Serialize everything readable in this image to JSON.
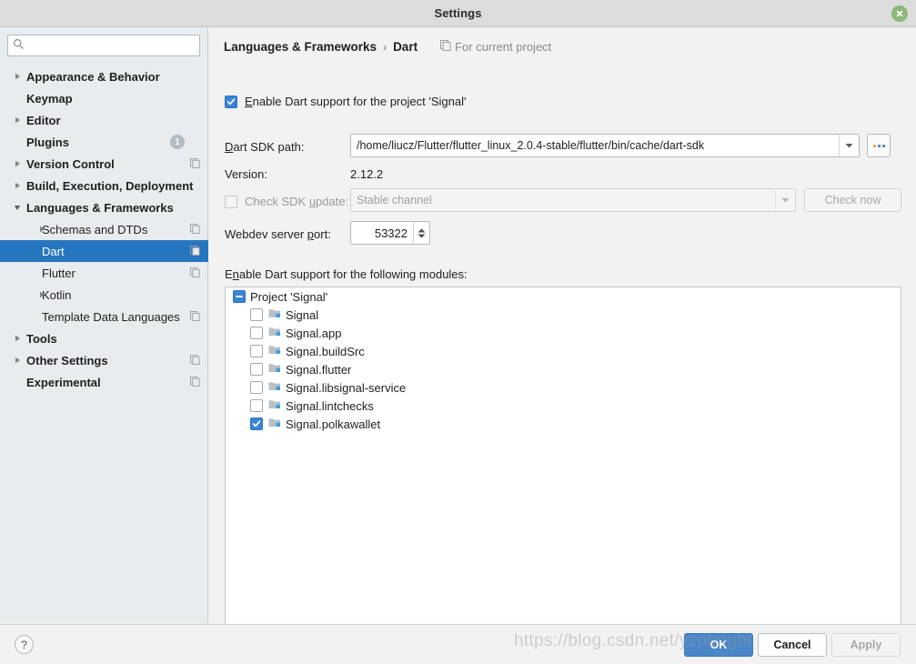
{
  "window": {
    "title": "Settings",
    "close_icon": "close-icon"
  },
  "sidebar": {
    "search": {
      "value": "",
      "placeholder": "",
      "icon": "search-icon"
    },
    "items": [
      {
        "label": "Appearance & Behavior",
        "level": 0,
        "bold": true,
        "arrow": "collapsed",
        "badge": "",
        "scope_icon": false
      },
      {
        "label": "Keymap",
        "level": 0,
        "bold": true,
        "arrow": "none",
        "badge": "",
        "scope_icon": false
      },
      {
        "label": "Editor",
        "level": 0,
        "bold": true,
        "arrow": "collapsed",
        "badge": "",
        "scope_icon": false
      },
      {
        "label": "Plugins",
        "level": 0,
        "bold": true,
        "arrow": "none",
        "badge": "1",
        "scope_icon": false
      },
      {
        "label": "Version Control",
        "level": 0,
        "bold": true,
        "arrow": "collapsed",
        "badge": "",
        "scope_icon": true
      },
      {
        "label": "Build, Execution, Deployment",
        "level": 0,
        "bold": true,
        "arrow": "collapsed",
        "badge": "",
        "scope_icon": false
      },
      {
        "label": "Languages & Frameworks",
        "level": 0,
        "bold": true,
        "arrow": "expanded",
        "badge": "",
        "scope_icon": false
      },
      {
        "label": "Schemas and DTDs",
        "level": 1,
        "bold": false,
        "arrow": "collapsed",
        "badge": "",
        "scope_icon": true
      },
      {
        "label": "Dart",
        "level": 1,
        "bold": false,
        "arrow": "none",
        "badge": "",
        "scope_icon": true,
        "selected": true
      },
      {
        "label": "Flutter",
        "level": 1,
        "bold": false,
        "arrow": "none",
        "badge": "",
        "scope_icon": true
      },
      {
        "label": "Kotlin",
        "level": 1,
        "bold": false,
        "arrow": "collapsed",
        "badge": "",
        "scope_icon": false
      },
      {
        "label": "Template Data Languages",
        "level": 1,
        "bold": false,
        "arrow": "none",
        "badge": "",
        "scope_icon": true
      },
      {
        "label": "Tools",
        "level": 0,
        "bold": true,
        "arrow": "collapsed",
        "badge": "",
        "scope_icon": false
      },
      {
        "label": "Other Settings",
        "level": 0,
        "bold": true,
        "arrow": "collapsed",
        "badge": "",
        "scope_icon": true
      },
      {
        "label": "Experimental",
        "level": 0,
        "bold": true,
        "arrow": "none",
        "badge": "",
        "scope_icon": true
      }
    ]
  },
  "main": {
    "breadcrumb": {
      "parent": "Languages & Frameworks",
      "separator": "›",
      "current": "Dart"
    },
    "scope_note": {
      "text": "For current project",
      "icon": "project-scope-icon"
    },
    "enable_support": {
      "checked": true,
      "label_mnemonic": "E",
      "label_rest": "nable Dart support for the project 'Signal'"
    },
    "sdk_path": {
      "label_mnemonic": "D",
      "label_rest": "art SDK path:",
      "value": "/home/liucz/Flutter/flutter_linux_2.0.4-stable/flutter/bin/cache/dart-sdk",
      "dropdown_icon": "chevron-down-icon",
      "browse_icon": "ellipsis-icon"
    },
    "version": {
      "label": "Version:",
      "value": "2.12.2"
    },
    "sdk_update": {
      "checked": false,
      "disabled": true,
      "label_pre": "Check SDK ",
      "label_mnemonic": "u",
      "label_post": "pdate:",
      "channel": "Stable channel",
      "check_now_label": "Check now",
      "dropdown_icon": "chevron-down-icon"
    },
    "webdev_port": {
      "label_pre": "Webdev server ",
      "label_mnemonic": "p",
      "label_post": "ort:",
      "value": "53322",
      "up_icon": "chevron-up-icon",
      "down_icon": "chevron-down-icon"
    },
    "modules": {
      "caption_pre": "E",
      "caption_mnemonic": "n",
      "caption_post": "able Dart support for the following modules:",
      "root": {
        "label": "Project 'Signal'",
        "state": "partial"
      },
      "items": [
        {
          "label": "Signal",
          "checked": false,
          "icon": "module-icon"
        },
        {
          "label": "Signal.app",
          "checked": false,
          "icon": "module-icon"
        },
        {
          "label": "Signal.buildSrc",
          "checked": false,
          "icon": "module-icon"
        },
        {
          "label": "Signal.flutter",
          "checked": false,
          "icon": "module-icon"
        },
        {
          "label": "Signal.libsignal-service",
          "checked": false,
          "icon": "module-icon"
        },
        {
          "label": "Signal.lintchecks",
          "checked": false,
          "icon": "module-icon"
        },
        {
          "label": "Signal.polkawallet",
          "checked": true,
          "icon": "module-icon"
        }
      ]
    }
  },
  "footer": {
    "help_label": "?",
    "ok_label": "OK",
    "cancel_label": "Cancel",
    "apply_label": "Apply"
  },
  "watermark": {
    "text": "https://blog.csdn.net/yzpbright"
  },
  "colors": {
    "selection_blue": "#2675bf",
    "accent_blue": "#3b84d4",
    "ok_button": "#4a86c8",
    "close_green": "#8cb878",
    "panel_bg": "#f2f2f2",
    "sidebar_bg": "#e8ecef"
  }
}
